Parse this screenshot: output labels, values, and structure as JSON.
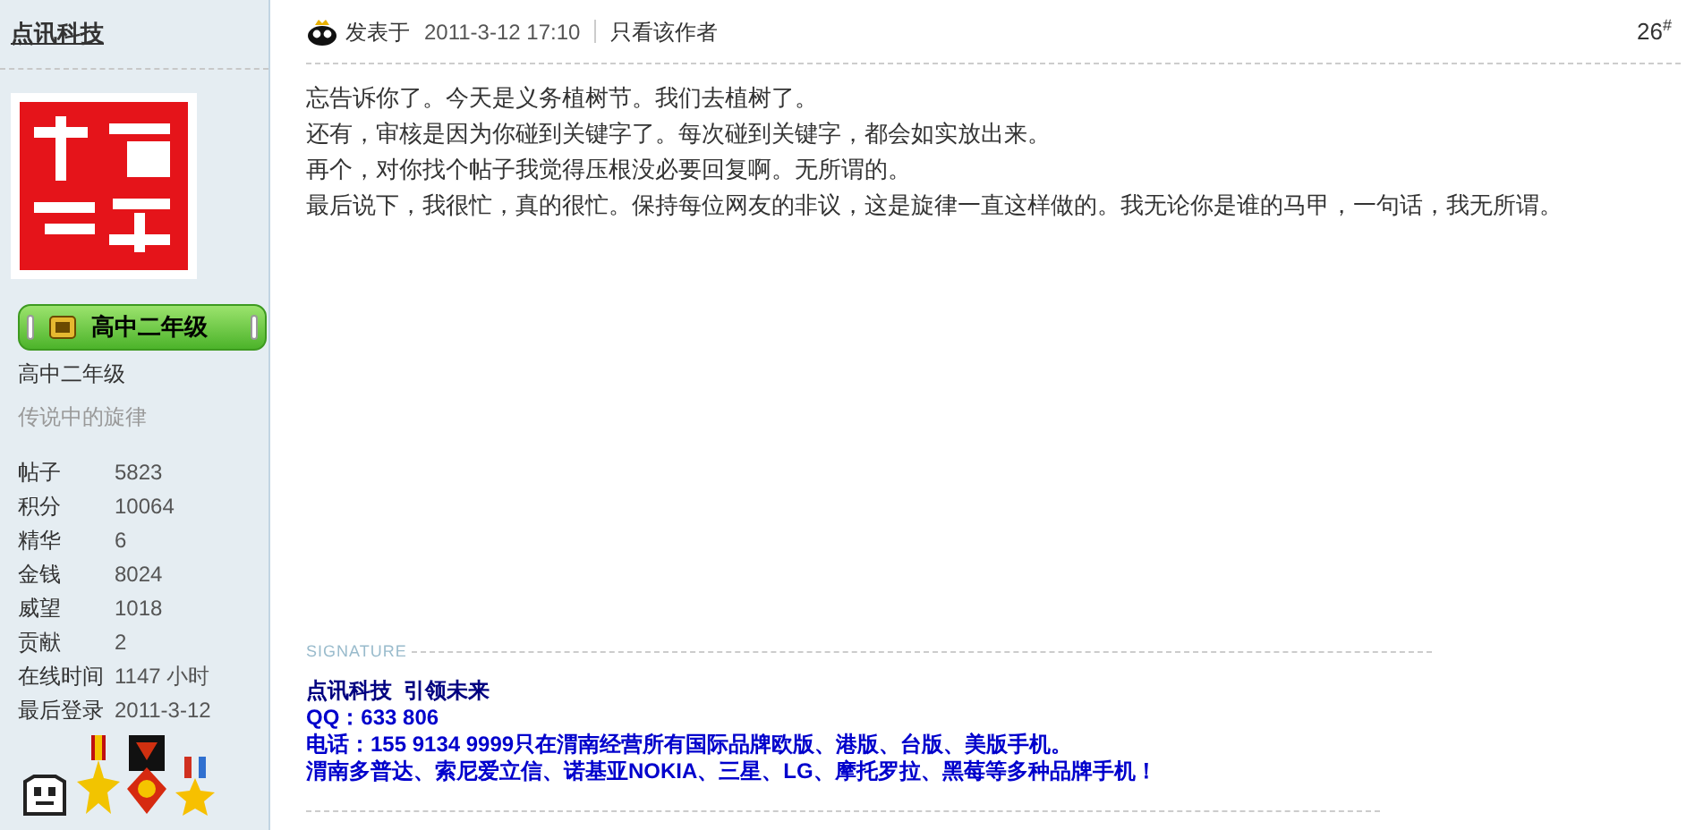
{
  "author": {
    "name": "点讯科技",
    "rank_badge": "高中二年级",
    "rank_title": "高中二年级",
    "custom_title": "传说中的旋律",
    "stats": [
      {
        "label": "帖子",
        "value": "5823"
      },
      {
        "label": "积分",
        "value": "10064"
      },
      {
        "label": "精华",
        "value": "6"
      },
      {
        "label": "金钱",
        "value": "8024"
      },
      {
        "label": "威望",
        "value": "1018"
      },
      {
        "label": "贡献",
        "value": "2"
      },
      {
        "label": "在线时间",
        "value": "1147 小时"
      },
      {
        "label": "最后登录",
        "value": "2011-3-12"
      }
    ],
    "medals": [
      {
        "kind": "cat"
      },
      {
        "kind": "star-medal"
      },
      {
        "kind": "banner-medal"
      },
      {
        "kind": "ribbon-star"
      }
    ]
  },
  "post": {
    "posted_label": "发表于",
    "posted_time": "2011-3-12 17:10",
    "author_only_link": "只看该作者",
    "floor": "26",
    "floor_mark": "#",
    "lines": [
      "忘告诉你了。今天是义务植树节。我们去植树了。",
      "还有，审核是因为你碰到关键字了。每次碰到关键字，都会如实放出来。",
      "再个，对你找个帖子我觉得压根没必要回复啊。无所谓的。",
      "最后说下，我很忙，真的很忙。保持每位网友的非议，这是旋律一直这样做的。我无论你是谁的马甲，一句话，我无所谓。"
    ],
    "signature": {
      "label": "SIGNATURE",
      "lines": [
        {
          "kind": "heading",
          "text": "点讯科技  引领未来"
        },
        {
          "kind": "plain",
          "text": "QQ：633 806"
        },
        {
          "kind": "plain",
          "text": "电话：155 9134 9999只在渭南经营所有国际品牌欧版、港版、台版、美版手机。"
        },
        {
          "kind": "plain",
          "text": "渭南多普达、索尼爱立信、诺基亚NOKIA、三星、LG、摩托罗拉、黑莓等多种品牌手机！"
        }
      ]
    }
  }
}
